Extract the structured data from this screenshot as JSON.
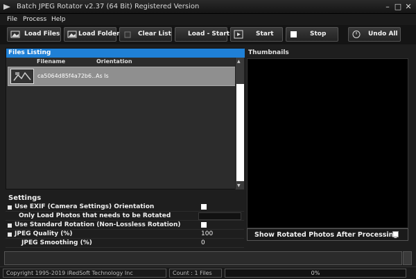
{
  "window": {
    "title": "Batch JPEG Rotator v2.37 (64 Bit) Registered Version"
  },
  "menu": [
    "File",
    "Process",
    "Help"
  ],
  "toolbar": {
    "load_files": "Load Files",
    "load_folders": "Load Folders",
    "clear_list": "Clear List",
    "load_start": "Load - Start",
    "start": "Start",
    "stop": "Stop",
    "undo_all": "Undo All"
  },
  "files": {
    "heading": "Files Listing",
    "col_filename": "Filename",
    "col_orientation": "Orientation",
    "rows": [
      {
        "filename": "ca5064d85f4a72b6...",
        "orientation": "As Is"
      }
    ]
  },
  "thumbnails": {
    "heading": "Thumbnails",
    "show_rotated_label": "Show Rotated Photos After Processing",
    "show_rotated_checked": false
  },
  "settings": {
    "heading": "Settings",
    "exif_label": "Use EXIF (Camera Settings) Orientation",
    "only_load_label": "Only Load Photos that needs to be Rotated",
    "standard_rotation_label": "Use Standard Rotation (Non-Lossless Rotation)",
    "jpeg_quality_label": "JPEG Quality (%)",
    "jpeg_quality_value": "100",
    "jpeg_smoothing_label": "JPEG Smoothing (%)",
    "jpeg_smoothing_value": "0"
  },
  "status": {
    "copyright": "Copyright 1995-2019 iRedSoft Technology Inc",
    "count": "Count : 1 Files",
    "progress_text": "0%",
    "progress_fraction": 0
  },
  "colors": {
    "accent": "#1f80d6",
    "background": "#1e1e1e",
    "thumb_area": "#000000"
  }
}
